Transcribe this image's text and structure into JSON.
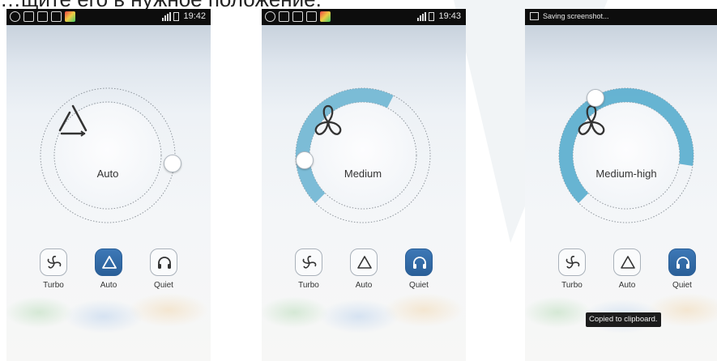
{
  "caption": "…щите его в нужное положение.",
  "screens": [
    {
      "status": {
        "time": "19:42"
      },
      "dial": {
        "mode_label": "Auto",
        "fill_fraction": 0.0
      },
      "modes": [
        {
          "label": "Turbo",
          "icon": "fan-icon",
          "active": false
        },
        {
          "label": "Auto",
          "icon": "auto-triangle-icon",
          "active": true
        },
        {
          "label": "Quiet",
          "icon": "headphones-icon",
          "active": false
        }
      ]
    },
    {
      "status": {
        "time": "19:43"
      },
      "dial": {
        "mode_label": "Medium",
        "fill_fraction": 0.45
      },
      "modes": [
        {
          "label": "Turbo",
          "icon": "fan-icon",
          "active": false
        },
        {
          "label": "Auto",
          "icon": "auto-triangle-icon",
          "active": false
        },
        {
          "label": "Quiet",
          "icon": "headphones-icon",
          "active": true
        }
      ]
    },
    {
      "status": {
        "notification": "Saving screenshot..."
      },
      "dial": {
        "mode_label": "Medium-high",
        "fill_fraction": 0.65
      },
      "modes": [
        {
          "label": "Turbo",
          "icon": "fan-icon",
          "active": false
        },
        {
          "label": "Auto",
          "icon": "auto-triangle-icon",
          "active": false
        },
        {
          "label": "Quiet",
          "icon": "headphones-icon",
          "active": true
        }
      ],
      "toast": "Copied to clipboard."
    }
  ],
  "colors": {
    "accent_blue": "#2e67a4",
    "dial_fill": "#5fb0d0"
  }
}
